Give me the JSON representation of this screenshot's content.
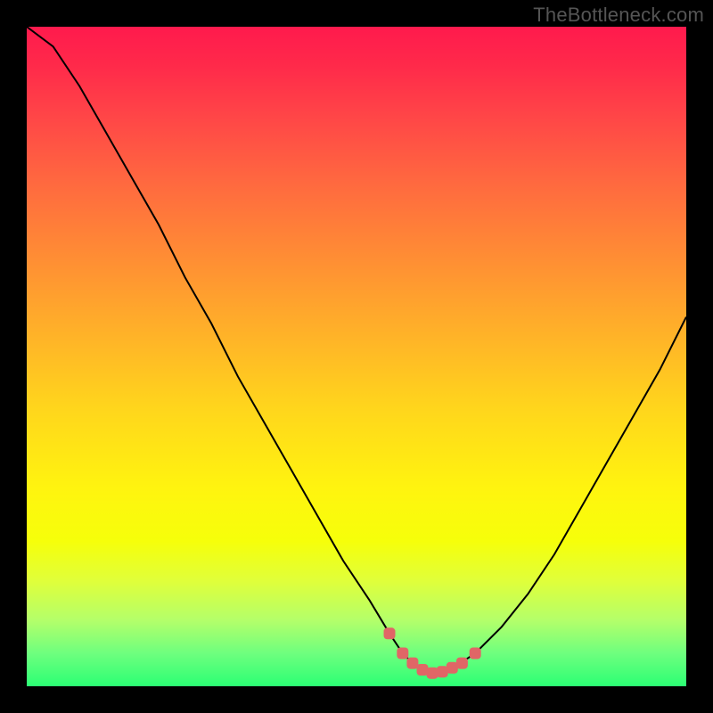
{
  "watermark": "TheBottleneck.com",
  "colors": {
    "page_bg": "#000000",
    "gradient_top": "#ff1a4d",
    "gradient_bottom": "#2cff74",
    "curve_stroke": "#000000",
    "marker_fill": "#e06666",
    "watermark_text": "#555555"
  },
  "chart_data": {
    "type": "line",
    "title": "",
    "xlabel": "",
    "ylabel": "",
    "xlim": [
      0,
      100
    ],
    "ylim": [
      0,
      100
    ],
    "grid": false,
    "legend": false,
    "series": [
      {
        "name": "curve",
        "x": [
          0,
          4,
          8,
          12,
          16,
          20,
          24,
          28,
          32,
          36,
          40,
          44,
          48,
          52,
          55,
          57,
          59,
          61,
          63,
          65,
          68,
          72,
          76,
          80,
          84,
          88,
          92,
          96,
          100
        ],
        "y": [
          100,
          97,
          91,
          84,
          77,
          70,
          62,
          55,
          47,
          40,
          33,
          26,
          19,
          13,
          8,
          5,
          3,
          2,
          2,
          3,
          5,
          9,
          14,
          20,
          27,
          34,
          41,
          48,
          56
        ]
      }
    ],
    "markers": {
      "name": "highlight",
      "x": [
        55,
        57,
        58.5,
        60,
        61.5,
        63,
        64.5,
        66,
        68
      ],
      "y": [
        8,
        5,
        3.5,
        2.5,
        2,
        2.2,
        2.8,
        3.5,
        5
      ]
    }
  }
}
